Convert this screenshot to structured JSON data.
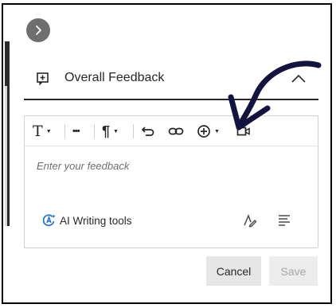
{
  "panel": {
    "section_title": "Overall Feedback"
  },
  "editor": {
    "placeholder": "Enter your feedback",
    "toolbar": {
      "text_style_icon": "T",
      "more_icon": "•••",
      "paragraph_icon": "¶"
    },
    "ai_tools_label": "AI Writing tools"
  },
  "actions": {
    "cancel_label": "Cancel",
    "save_label": "Save",
    "save_disabled": true
  },
  "colors": {
    "annotation_arrow": "#14123f",
    "primary_text": "#262626",
    "ai_icon": "#1f6fd1"
  }
}
